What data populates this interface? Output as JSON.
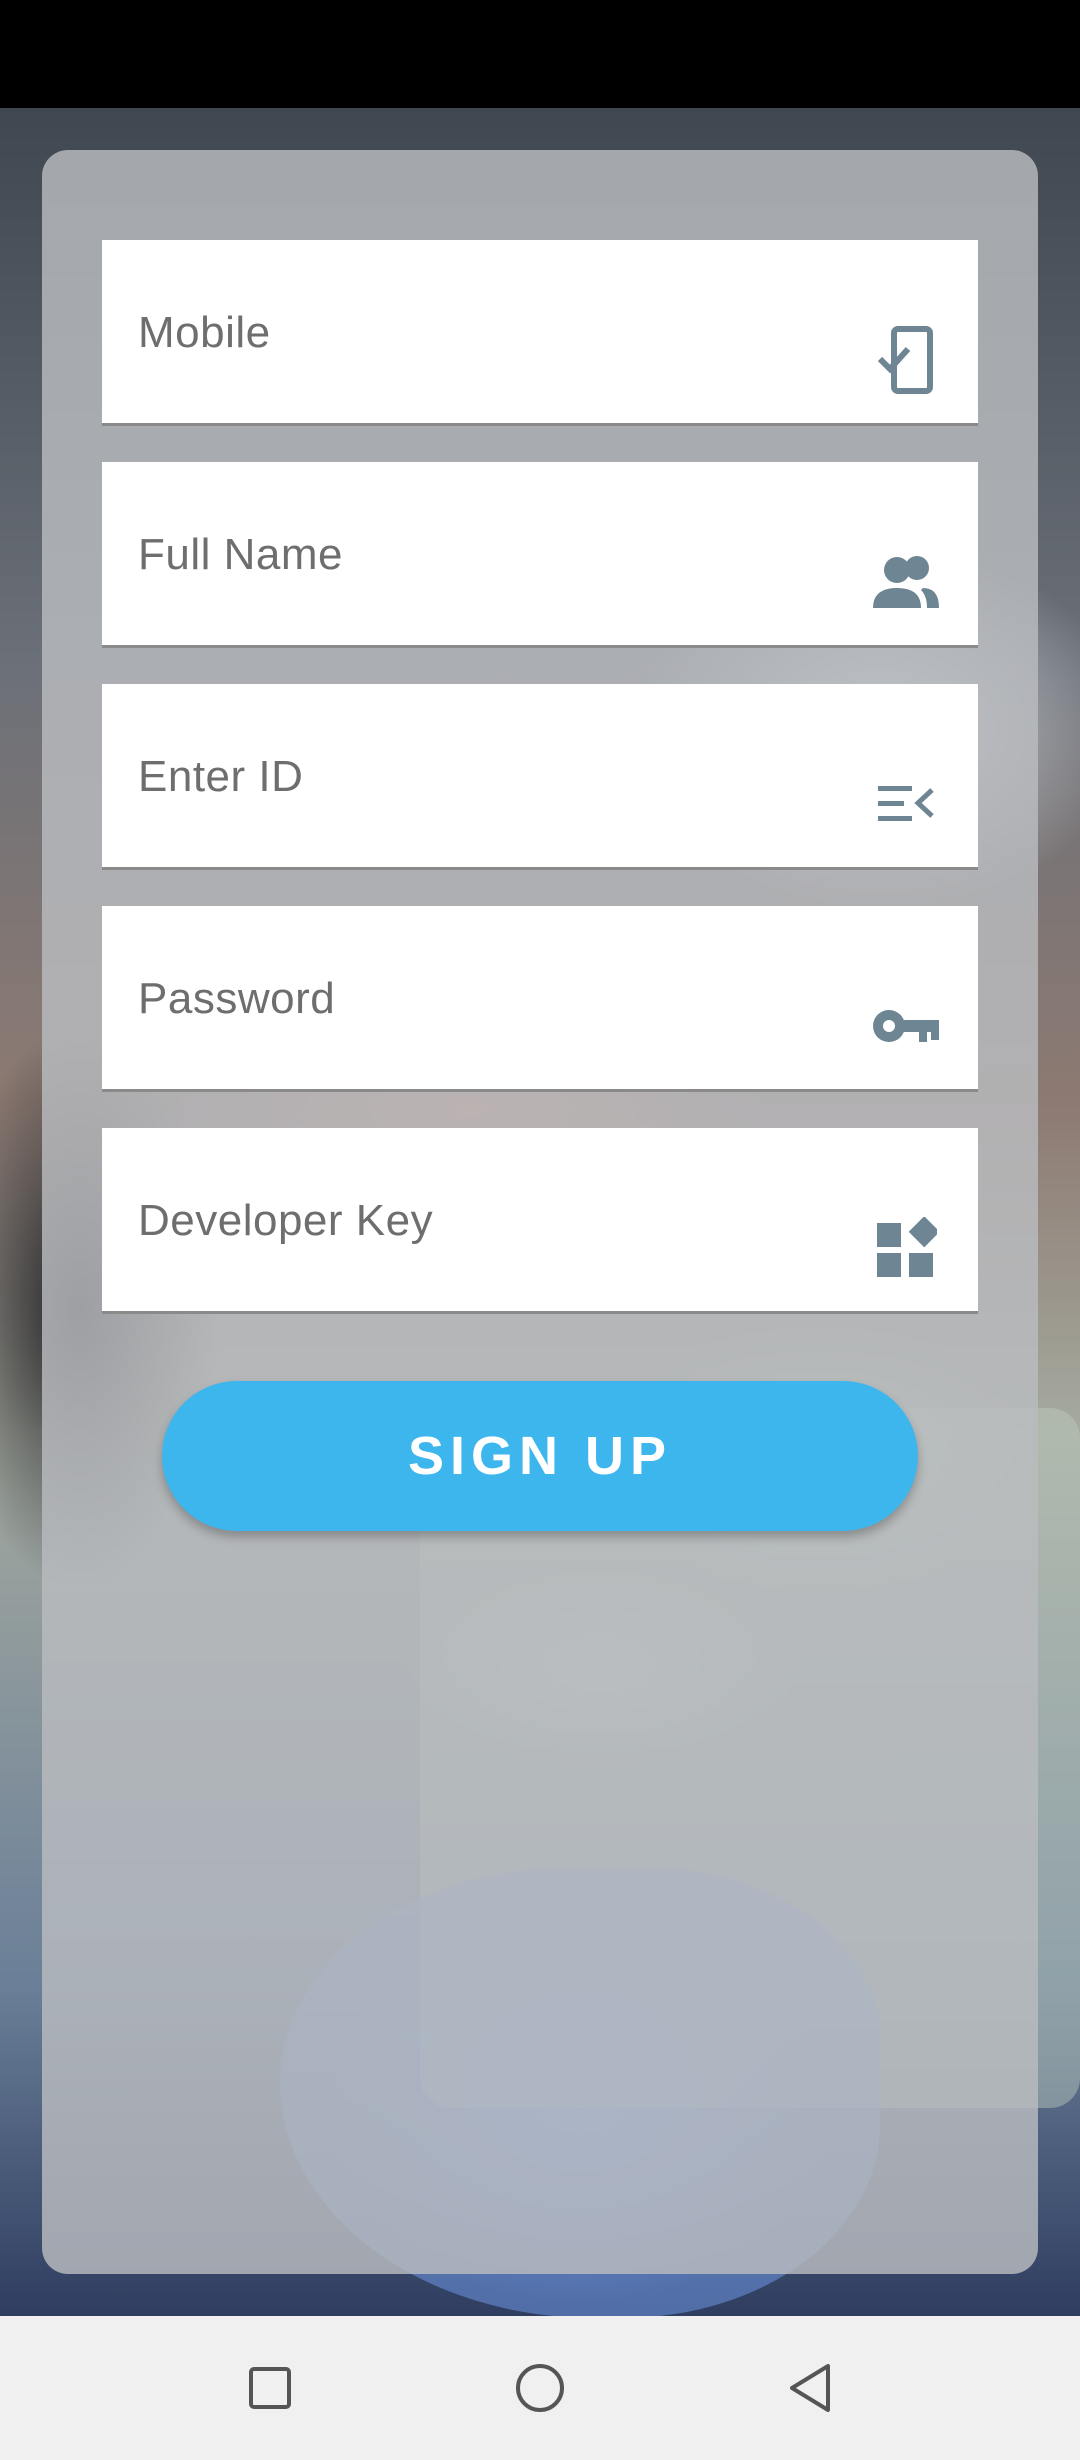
{
  "form": {
    "fields": [
      {
        "label": "Mobile",
        "icon": "mobile-check-icon"
      },
      {
        "label": "Full Name",
        "icon": "people-icon"
      },
      {
        "label": "Enter ID",
        "icon": "list-id-icon"
      },
      {
        "label": "Password",
        "icon": "key-icon"
      },
      {
        "label": "Developer Key",
        "icon": "widgets-icon"
      }
    ],
    "signup_label": "SIGN UP"
  },
  "colors": {
    "accent": "#3db6ee",
    "icon": "#6e8593",
    "label": "#6e6e6e"
  },
  "navbar": {
    "icons": [
      "recents-square-icon",
      "home-circle-icon",
      "back-triangle-icon"
    ]
  }
}
